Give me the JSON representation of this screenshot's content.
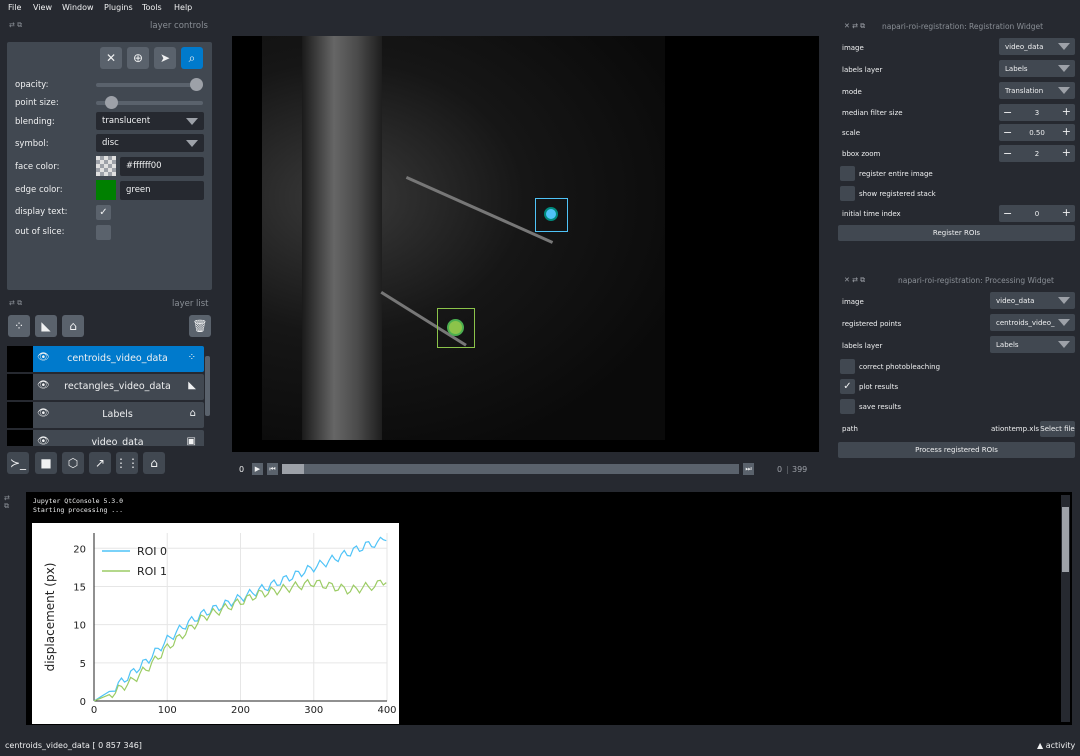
{
  "menu": [
    "File",
    "View",
    "Window",
    "Plugins",
    "Tools",
    "Help"
  ],
  "layer_controls": {
    "title": "layer controls",
    "rows": {
      "opacity": "opacity:",
      "point_size": "point size:",
      "blending": "blending:",
      "symbol": "symbol:",
      "face_color": "face color:",
      "edge_color": "edge color:",
      "display_text": "display text:",
      "out_of_slice": "out of slice:"
    },
    "opacity_value": 1.0,
    "point_size_value": 0.1,
    "blending_value": "translucent",
    "symbol_value": "disc",
    "face_color_value": "#ffffff00",
    "edge_color_value": "green",
    "edge_swatch": "#008000",
    "display_text_checked": true,
    "out_of_slice_checked": false
  },
  "layer_list": {
    "title": "layer list",
    "layers": [
      {
        "name": "centroids_video_data",
        "selected": true
      },
      {
        "name": "rectangles_video_data",
        "selected": false
      },
      {
        "name": "Labels",
        "selected": false
      },
      {
        "name": "video_data",
        "selected": false
      }
    ]
  },
  "dims": {
    "current": "0",
    "slider_start": "0",
    "slider_max": "399"
  },
  "registration_widget": {
    "title": "napari-roi-registration: Registration Widget",
    "image_label": "image",
    "image_value": "video_data",
    "labels_label": "labels layer",
    "labels_value": "Labels",
    "mode_label": "mode",
    "mode_value": "Translation",
    "median_label": "median filter size",
    "median_value": "3",
    "scale_label": "scale",
    "scale_value": "0.50",
    "bbox_label": "bbox zoom",
    "bbox_value": "2",
    "register_entire_label": "register entire image",
    "show_stack_label": "show registered stack",
    "time_index_label": "initial time index",
    "time_index_value": "0",
    "button": "Register ROIs"
  },
  "processing_widget": {
    "title": "napari-roi-registration: Processing Widget",
    "image_label": "image",
    "image_value": "video_data",
    "points_label": "registered points",
    "points_value": "centroids_video_",
    "labels_label": "labels layer",
    "labels_value": "Labels",
    "photobleach_label": "correct photobleaching",
    "plot_label": "plot results",
    "save_label": "save results",
    "path_label": "path",
    "path_value": "ationtemp.xls",
    "select_file": "Select file",
    "button": "Process registered ROIs"
  },
  "console": {
    "line1": "Jupyter QtConsole 5.3.0",
    "line2": "Starting processing ..."
  },
  "status": {
    "left": "centroids_video_data [  0 857 346]",
    "right": "activity"
  },
  "chart_data": {
    "type": "line",
    "ylabel": "displacement (px)",
    "xlabel": "",
    "xlim": [
      0,
      400
    ],
    "ylim": [
      0,
      22
    ],
    "xticks": [
      0,
      100,
      200,
      300,
      400
    ],
    "yticks": [
      0,
      5,
      10,
      15,
      20
    ],
    "legend": "top-left",
    "grid": true,
    "series": [
      {
        "name": "ROI 0",
        "color": "#4fc3f7",
        "x": [
          0,
          25,
          50,
          75,
          100,
          125,
          150,
          175,
          200,
          225,
          250,
          275,
          300,
          325,
          350,
          375,
          399
        ],
        "y": [
          0,
          1.5,
          3.5,
          5.5,
          8,
          10,
          11.5,
          12.5,
          13.5,
          14.5,
          15.5,
          16.5,
          17.5,
          18.5,
          19.5,
          20.5,
          21
        ]
      },
      {
        "name": "ROI 1",
        "color": "#9ccc65",
        "x": [
          0,
          25,
          50,
          75,
          100,
          125,
          150,
          175,
          200,
          225,
          250,
          275,
          300,
          325,
          350,
          375,
          399
        ],
        "y": [
          0,
          1,
          2.5,
          4.5,
          7,
          9,
          11,
          12,
          13,
          14,
          14.5,
          15,
          15.5,
          15,
          14.5,
          15,
          15.5
        ]
      }
    ]
  }
}
